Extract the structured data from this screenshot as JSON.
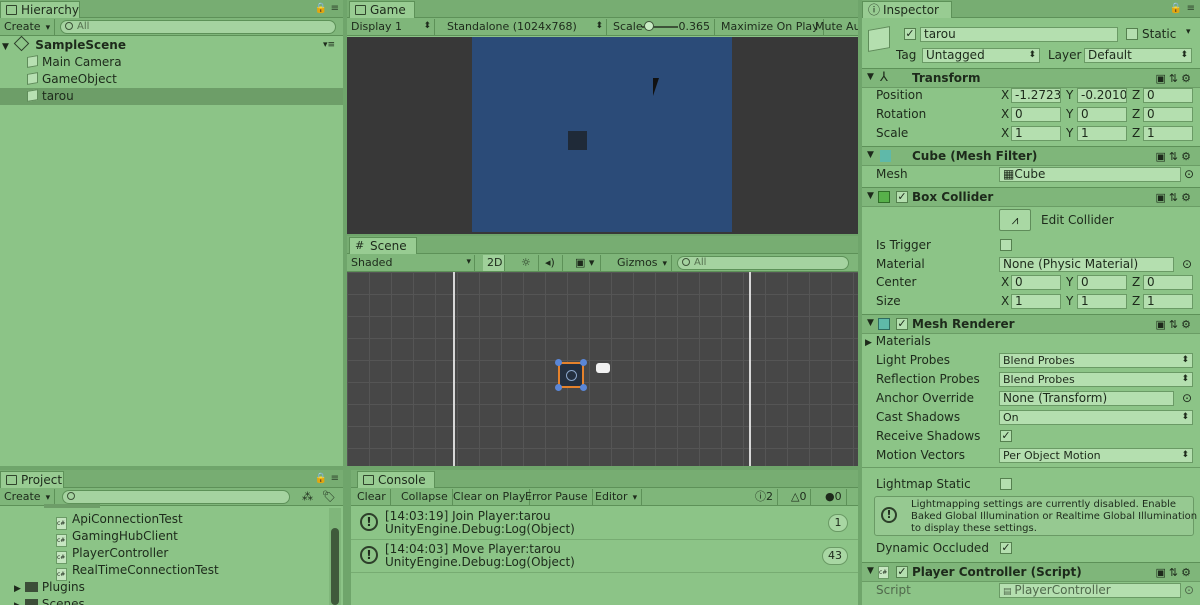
{
  "hierarchy": {
    "tab": "Hierarchy",
    "create": "Create",
    "search_placeholder": "All",
    "scene": "SampleScene",
    "items": [
      "Main Camera",
      "GameObject",
      "tarou"
    ]
  },
  "game": {
    "tab": "Game",
    "display": "Display 1",
    "resolution": "Standalone (1024x768)",
    "scale_label": "Scale",
    "scale_value": "0.365",
    "maximize": "Maximize On Play",
    "mute": "Mute Au"
  },
  "scene_view": {
    "tab": "Scene",
    "shading": "Shaded",
    "mode_2d": "2D",
    "gizmos": "Gizmos",
    "search_placeholder": "All"
  },
  "project": {
    "tab": "Project",
    "create": "Create",
    "items": [
      {
        "name": "ApiConnectionTest",
        "type": "script"
      },
      {
        "name": "GamingHubClient",
        "type": "script"
      },
      {
        "name": "PlayerController",
        "type": "script"
      },
      {
        "name": "RealTimeConnectionTest",
        "type": "script"
      },
      {
        "name": "Plugins",
        "type": "folder"
      },
      {
        "name": "Scenes",
        "type": "folder"
      }
    ]
  },
  "console": {
    "tab": "Console",
    "buttons": [
      "Clear",
      "Collapse",
      "Clear on Play",
      "Error Pause",
      "Editor"
    ],
    "counts": {
      "info": "2",
      "warn": "0",
      "error": "0"
    },
    "rows": [
      {
        "line1": "[14:03:19] Join Player:tarou",
        "line2": "UnityEngine.Debug:Log(Object)",
        "count": "1"
      },
      {
        "line1": "[14:04:03] Move Player:tarou",
        "line2": "UnityEngine.Debug:Log(Object)",
        "count": "43"
      }
    ]
  },
  "inspector": {
    "tab": "Inspector",
    "name": "tarou",
    "static_label": "Static",
    "tag_label": "Tag",
    "tag_value": "Untagged",
    "layer_label": "Layer",
    "layer_value": "Default",
    "transform": {
      "title": "Transform",
      "position_label": "Position",
      "position": [
        "-1.2723",
        "-0.2010",
        "0"
      ],
      "rotation_label": "Rotation",
      "rotation": [
        "0",
        "0",
        "0"
      ],
      "scale_label": "Scale",
      "scale": [
        "1",
        "1",
        "1"
      ]
    },
    "mesh_filter": {
      "title": "Cube (Mesh Filter)",
      "mesh_label": "Mesh",
      "mesh_value": "Cube"
    },
    "box_collider": {
      "title": "Box Collider",
      "edit": "Edit Collider",
      "is_trigger_label": "Is Trigger",
      "material_label": "Material",
      "material_value": "None (Physic Material)",
      "center_label": "Center",
      "center": [
        "0",
        "0",
        "0"
      ],
      "size_label": "Size",
      "size": [
        "1",
        "1",
        "1"
      ]
    },
    "mesh_renderer": {
      "title": "Mesh Renderer",
      "materials": "Materials",
      "light_probes_label": "Light Probes",
      "light_probes": "Blend Probes",
      "reflection_probes_label": "Reflection Probes",
      "reflection_probes": "Blend Probes",
      "anchor_label": "Anchor Override",
      "anchor": "None (Transform)",
      "cast_label": "Cast Shadows",
      "cast": "On",
      "receive_label": "Receive Shadows",
      "motion_label": "Motion Vectors",
      "motion": "Per Object Motion",
      "lightmap_label": "Lightmap Static",
      "info": [
        "Lightmapping settings are currently disabled. Enable",
        "Baked Global Illumination or Realtime Global Illumination",
        "to display these settings."
      ],
      "dynamic_label": "Dynamic Occluded"
    },
    "player_controller": {
      "title": "Player Controller (Script)",
      "script_label": "Script",
      "script_value": "PlayerController"
    }
  },
  "axes": {
    "x": "X",
    "y": "Y",
    "z": "Z"
  }
}
